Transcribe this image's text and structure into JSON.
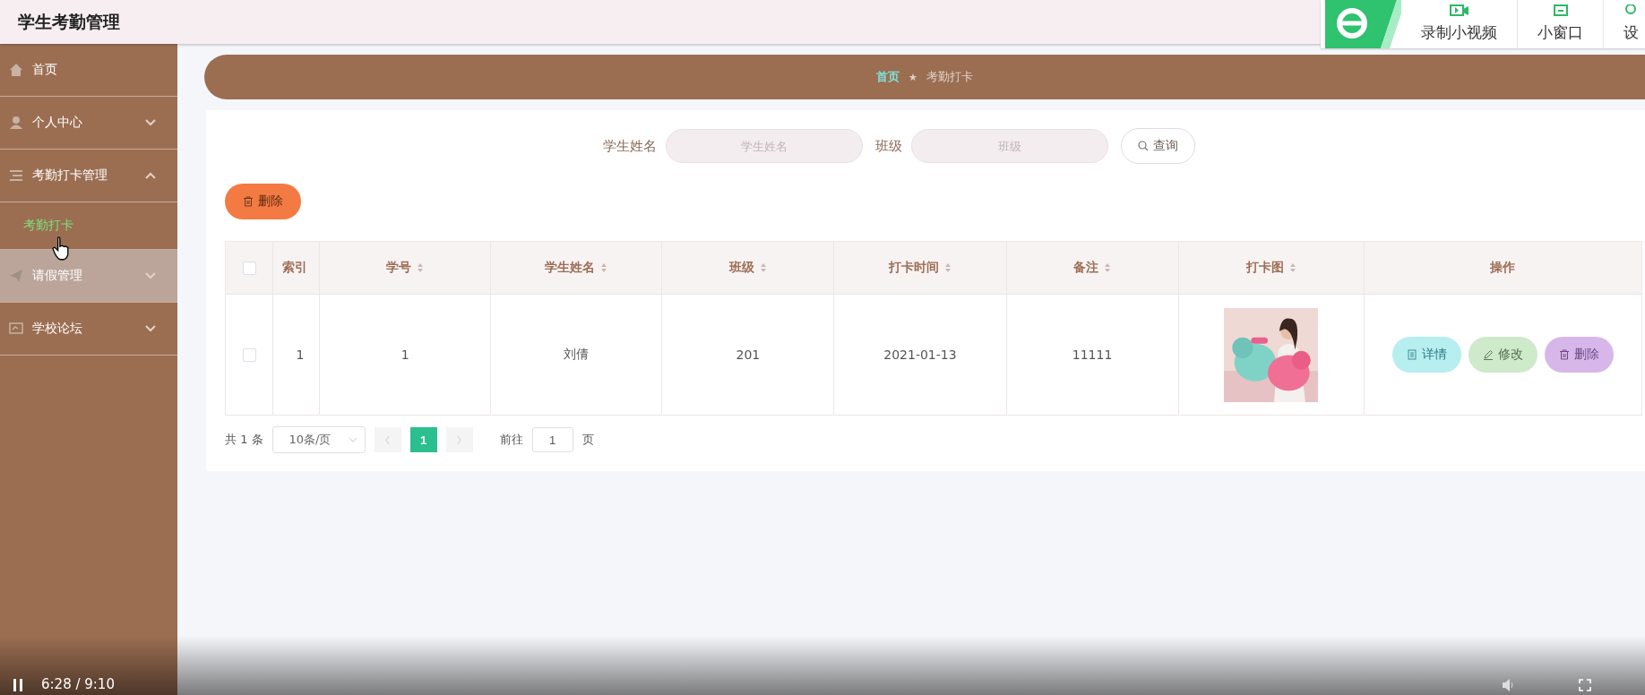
{
  "app_title": "学生考勤管理",
  "browser_toolbar": {
    "items": [
      {
        "kind": "record",
        "label": "录制小视频"
      },
      {
        "kind": "window",
        "label": "小窗口"
      },
      {
        "kind": "settings",
        "label": "设"
      }
    ]
  },
  "sidebar": {
    "items": [
      {
        "kind": "home",
        "label": "首页",
        "hovered": false
      },
      {
        "kind": "user",
        "label": "个人中心",
        "expanded": false,
        "hovered": false
      },
      {
        "kind": "list",
        "label": "考勤打卡管理",
        "expanded": true,
        "hovered": false,
        "children": [
          {
            "label": "考勤打卡",
            "selected": true
          }
        ]
      },
      {
        "kind": "send",
        "label": "请假管理",
        "expanded": false,
        "hovered": true
      },
      {
        "kind": "forum",
        "label": "学校论坛",
        "expanded": false,
        "hovered": false
      }
    ]
  },
  "breadcrumb": {
    "items": [
      {
        "label": "首页",
        "selected": true
      },
      {
        "label": "考勤打卡",
        "selected": false
      }
    ],
    "separator": "★"
  },
  "search": {
    "fields": [
      {
        "label": "学生姓名",
        "placeholder": "学生姓名"
      },
      {
        "label": "班级",
        "placeholder": "班级"
      }
    ],
    "button": "查询"
  },
  "delete_button": "删除",
  "table": {
    "select_all_checked": false,
    "columns": [
      {
        "label": "索引",
        "sortable": false
      },
      {
        "label": "学号",
        "sortable": true
      },
      {
        "label": "学生姓名",
        "sortable": true
      },
      {
        "label": "班级",
        "sortable": true
      },
      {
        "label": "打卡时间",
        "sortable": true
      },
      {
        "label": "备注",
        "sortable": true
      },
      {
        "label": "打卡图",
        "sortable": true
      },
      {
        "label": "操作",
        "sortable": false
      }
    ],
    "rows": [
      {
        "checked": false,
        "cells": [
          "1",
          "1",
          "刘倩",
          "201",
          "2021-01-13",
          "11111"
        ],
        "actions": [
          {
            "kind": "detail",
            "label": "详情"
          },
          {
            "kind": "edit",
            "label": "修改"
          },
          {
            "kind": "delete",
            "label": "删除"
          }
        ]
      }
    ]
  },
  "pagination": {
    "total": "共 1 条",
    "page_size": "10条/页",
    "pages": [
      {
        "label": "1",
        "selected": true
      }
    ],
    "goto_label": "前往",
    "goto_value": "1",
    "goto_suffix": "页"
  },
  "video_player": {
    "playing": true,
    "time": "6:28 / 9:10"
  }
}
